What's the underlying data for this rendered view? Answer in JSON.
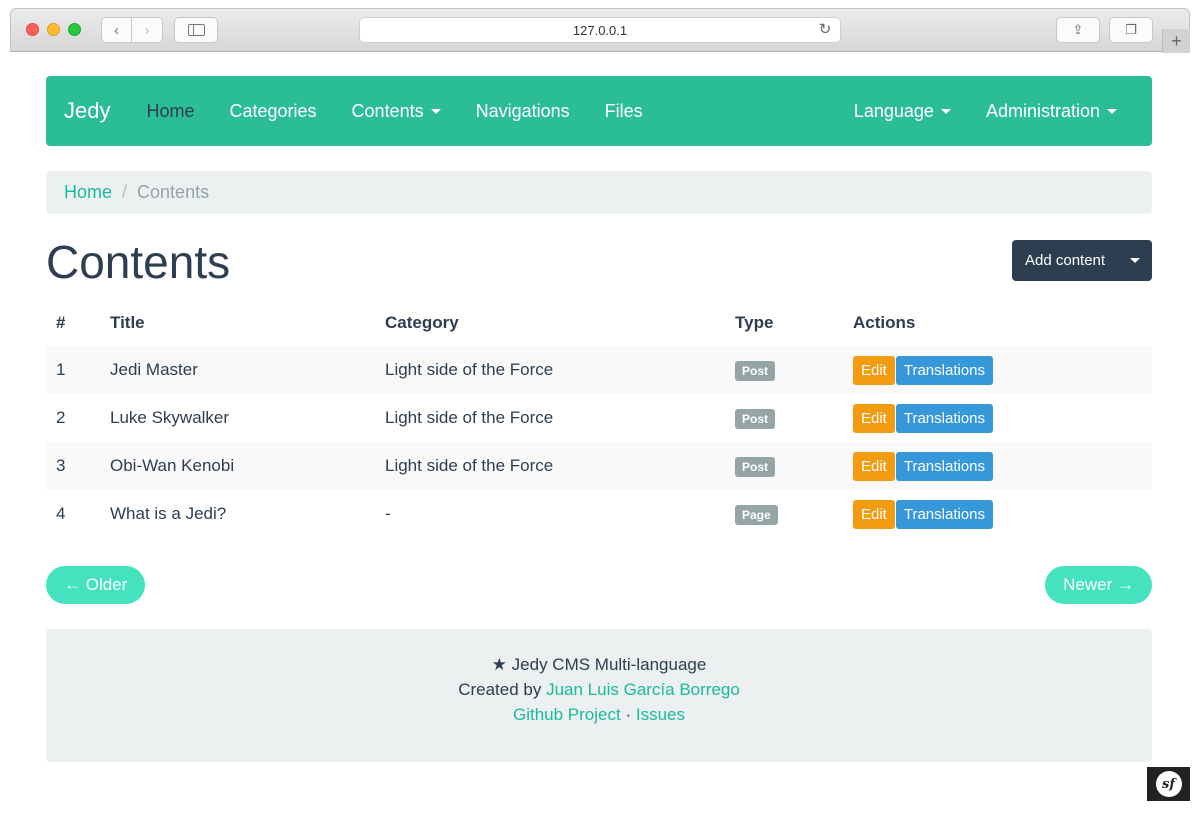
{
  "browser": {
    "url": "127.0.0.1",
    "icons": [
      "back-arrow-icon",
      "forward-arrow-icon",
      "sidebar-icon",
      "reload-icon",
      "share-icon",
      "tabs-icon",
      "plus-icon"
    ]
  },
  "navbar": {
    "brand": "Jedy",
    "items": [
      {
        "label": "Home",
        "active": true
      },
      {
        "label": "Categories"
      },
      {
        "label": "Contents",
        "dropdown": true
      },
      {
        "label": "Navigations"
      },
      {
        "label": "Files"
      }
    ],
    "right_items": [
      {
        "label": "Language",
        "dropdown": true
      },
      {
        "label": "Administration",
        "dropdown": true
      }
    ],
    "color": "#2bbd98"
  },
  "breadcrumb": {
    "home": "Home",
    "separator": "/",
    "current": "Contents"
  },
  "page": {
    "title": "Contents",
    "add_button": "Add content"
  },
  "table": {
    "headers": [
      "#",
      "Title",
      "Category",
      "Type",
      "Actions"
    ],
    "rows": [
      {
        "id": "1",
        "title": "Jedi Master",
        "category": "Light side of the Force",
        "type": "Post"
      },
      {
        "id": "2",
        "title": "Luke Skywalker",
        "category": "Light side of the Force",
        "type": "Post"
      },
      {
        "id": "3",
        "title": "Obi-Wan Kenobi",
        "category": "Light side of the Force",
        "type": "Post"
      },
      {
        "id": "4",
        "title": "What is a Jedi?",
        "category": "-",
        "type": "Page"
      }
    ],
    "edit_label": "Edit",
    "translations_label": "Translations"
  },
  "pager": {
    "older": "← Older",
    "newer": "Newer →"
  },
  "footer": {
    "title": "Jedy CMS Multi-language",
    "created_by": "Created by",
    "author": "Juan Luis García Borrego",
    "github": "Github Project",
    "dot": "·",
    "issues": "Issues"
  },
  "symfony_badge": "sf"
}
